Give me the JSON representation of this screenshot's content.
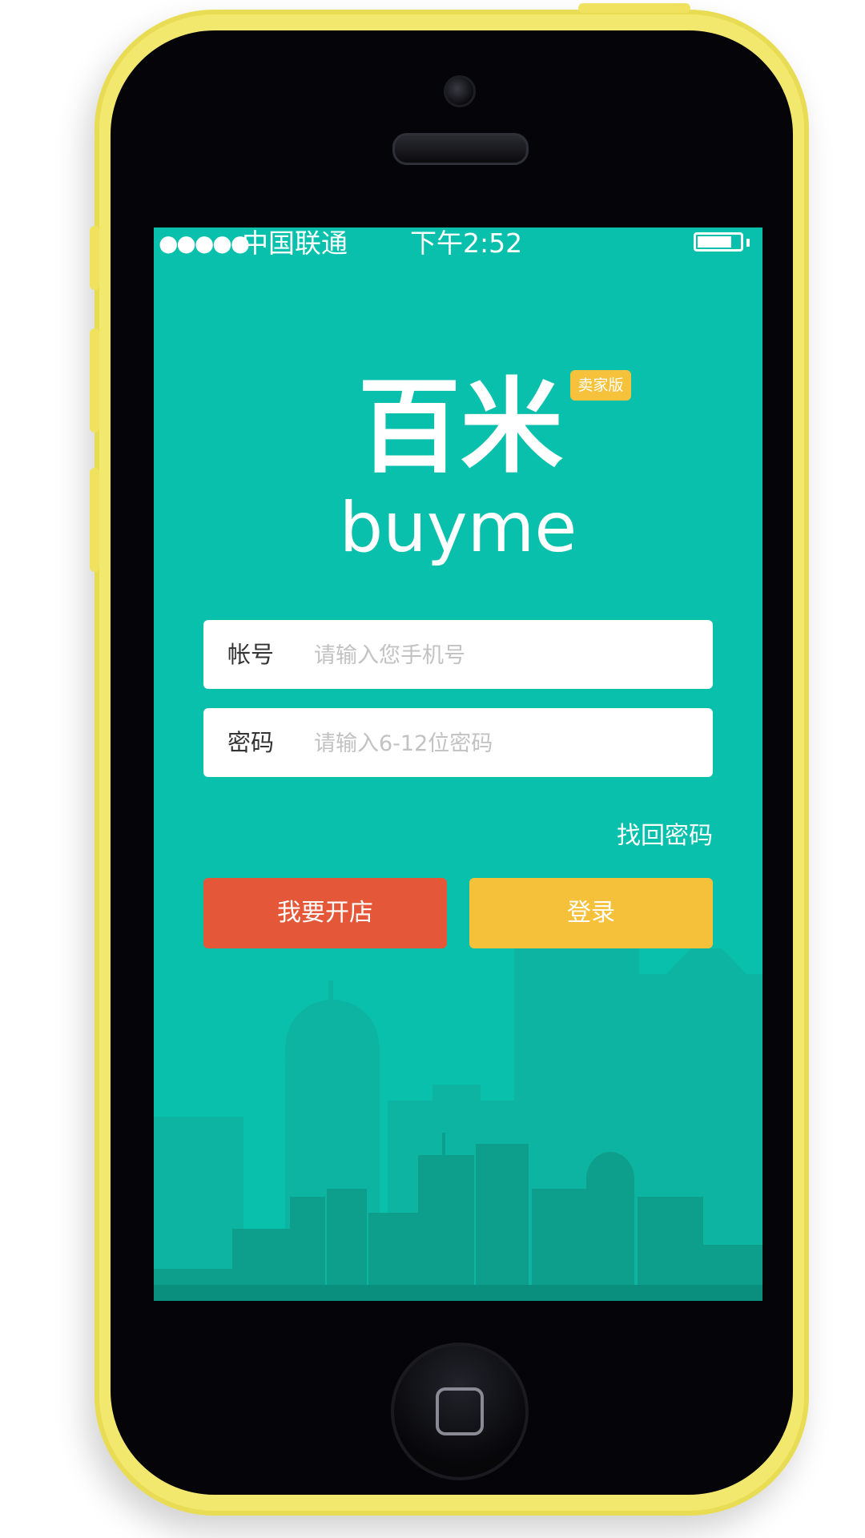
{
  "status_bar": {
    "signal": "●●●●●",
    "carrier": "中国联通",
    "time": "下午2:52"
  },
  "brand": {
    "name_cn": "百米",
    "name_en": "buyme",
    "badge": "卖家版"
  },
  "form": {
    "account": {
      "label": "帐号",
      "placeholder": "请输入您手机号",
      "value": ""
    },
    "password": {
      "label": "密码",
      "placeholder": "请输入6-12位密码",
      "value": ""
    },
    "forgot_label": "找回密码"
  },
  "actions": {
    "open_store_label": "我要开店",
    "login_label": "登录"
  },
  "colors": {
    "screen_bg": "#08c0ab",
    "open_store": "#e45739",
    "login": "#f6c13a",
    "badge": "#f6c23c",
    "phone_shell": "#f3e86e"
  },
  "icons": [
    "signal-icon",
    "battery-icon",
    "home-button-icon",
    "camera-icon",
    "speaker-icon",
    "city-skyline-illustration"
  ]
}
